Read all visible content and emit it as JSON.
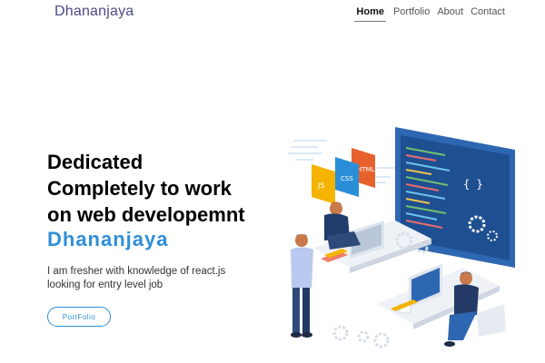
{
  "nav": {
    "brand": "Dhananjaya",
    "links": [
      {
        "label": "Home",
        "active": true
      },
      {
        "label": "Portfolio",
        "active": false
      },
      {
        "label": "About",
        "active": false
      },
      {
        "label": "Contact",
        "active": false
      }
    ]
  },
  "hero": {
    "headline_lines": [
      "Dedicated",
      "Completely to work",
      "on web developemnt"
    ],
    "name": "Dhananjaya",
    "desc_lines": [
      "I am fresher with knowledge of react.js",
      "looking for entry level job"
    ],
    "cta_label": "PortFolio"
  },
  "illustration": {
    "badges": [
      "JS",
      "CSS",
      "HTML"
    ],
    "monitor_symbol": "{ }"
  },
  "colors": {
    "brand": "#4a4a8a",
    "accent": "#2f8fd8",
    "monitor": "#2e67b1",
    "badge_js": "#f4b400",
    "badge_css": "#2a8fd8",
    "badge_html": "#e8612c"
  }
}
